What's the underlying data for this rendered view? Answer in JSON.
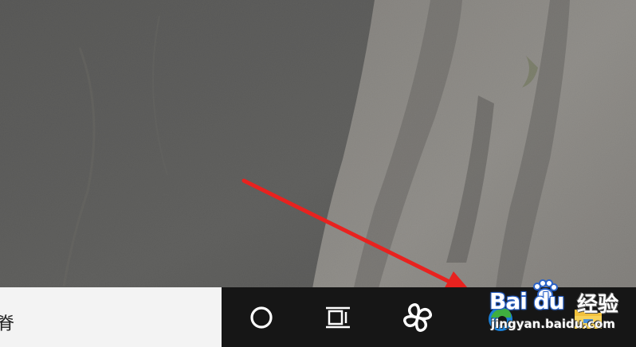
{
  "desktop": {
    "wallpaper_icon": "rock-cliff-photo"
  },
  "taskbar": {
    "search_text": "脊",
    "buttons": [
      {
        "icon": "cortana-circle-icon"
      },
      {
        "icon": "task-view-icon"
      },
      {
        "icon": "pinwheel-app-icon"
      },
      {
        "icon": "edge-browser-icon"
      },
      {
        "icon": "file-explorer-icon"
      }
    ]
  },
  "annotation": {
    "arrow_color": "#e8221f"
  },
  "watermark": {
    "brand": "Bai du",
    "cn": "经验",
    "url": "jingyan.baidu.com"
  }
}
